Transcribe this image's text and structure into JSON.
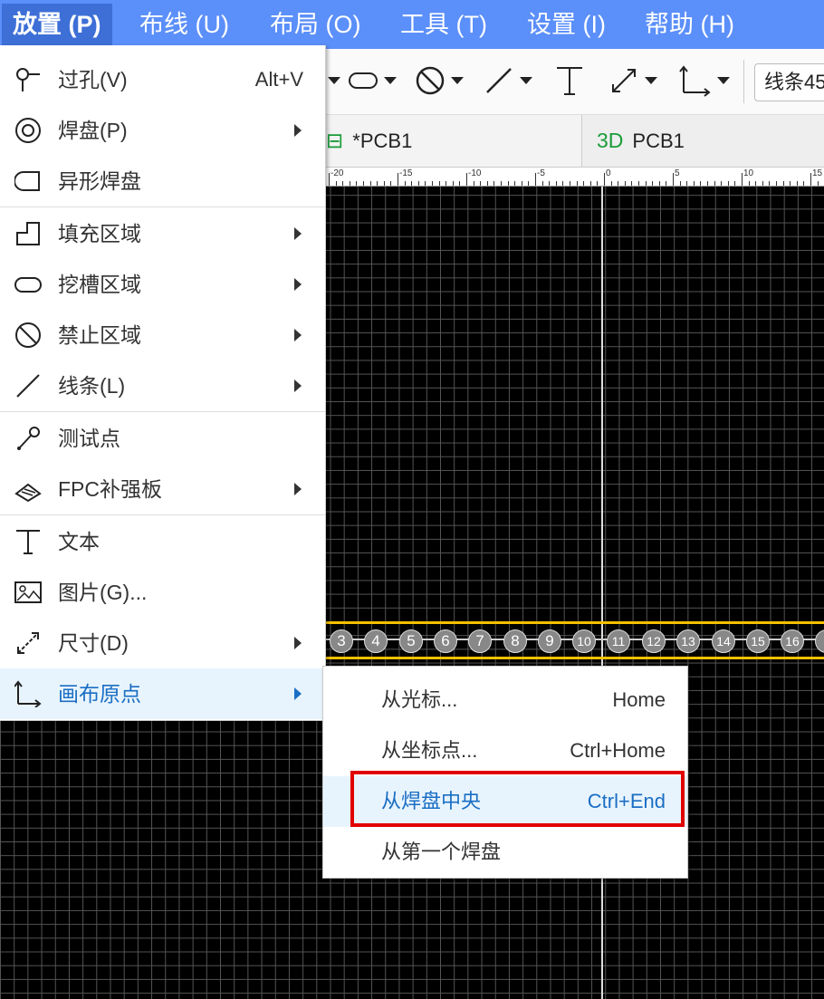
{
  "menubar": {
    "items": [
      "放置 (P)",
      "布线 (U)",
      "布局 (O)",
      "工具 (T)",
      "设置 (I)",
      "帮助 (H)"
    ],
    "active_index": 0
  },
  "toolbar": {
    "icons": [
      "pad-shape-icon",
      "oval-icon",
      "forbid-icon",
      "line-icon",
      "text-icon",
      "dimension-icon",
      "origin-icon"
    ],
    "layer_select_value": "线条45"
  },
  "tabs": [
    {
      "icon_text": "⊟",
      "label": "*PCB1"
    },
    {
      "icon_text": "3D",
      "label": "PCB1"
    }
  ],
  "ruler": {
    "labels": [
      "-20",
      "-15",
      "-10",
      "-5",
      "0",
      "5",
      "10",
      "15"
    ]
  },
  "pads": [
    "3",
    "4",
    "5",
    "6",
    "7",
    "8",
    "9",
    "10",
    "11",
    "12",
    "13",
    "14",
    "15",
    "16",
    "1"
  ],
  "colors": {
    "menubar": "#5b8ff9",
    "hover_text": "#1a6ec4",
    "hover_bg": "#e8f4fd",
    "highlight": "#e00000",
    "pad_track": "#f5c000"
  },
  "menu": {
    "items": [
      {
        "icon": "via-icon",
        "label": "过孔(V)",
        "shortcut": "Alt+V"
      },
      {
        "icon": "pad-icon",
        "label": "焊盘(P)",
        "submenu": true
      },
      {
        "icon": "special-pad-icon",
        "label": "异形焊盘"
      },
      {
        "icon": "fill-region-icon",
        "label": "填充区域",
        "submenu": true
      },
      {
        "icon": "slot-region-icon",
        "label": "挖槽区域",
        "submenu": true
      },
      {
        "icon": "keepout-region-icon",
        "label": "禁止区域",
        "submenu": true
      },
      {
        "icon": "line-icon",
        "label": "线条(L)",
        "submenu": true
      },
      {
        "icon": "test-point-icon",
        "label": "测试点"
      },
      {
        "icon": "fpc-stiffener-icon",
        "label": "FPC补强板",
        "submenu": true
      },
      {
        "icon": "text-icon",
        "label": "文本"
      },
      {
        "icon": "image-icon",
        "label": "图片(G)..."
      },
      {
        "icon": "dimension-icon",
        "label": "尺寸(D)",
        "submenu": true
      },
      {
        "icon": "canvas-origin-icon",
        "label": "画布原点",
        "submenu": true,
        "hover": true
      }
    ]
  },
  "submenu": {
    "items": [
      {
        "label": "从光标...",
        "shortcut": "Home"
      },
      {
        "label": "从坐标点...",
        "shortcut": "Ctrl+Home"
      },
      {
        "label": "从焊盘中央",
        "shortcut": "Ctrl+End",
        "hover": true,
        "highlighted": true
      },
      {
        "label": "从第一个焊盘",
        "shortcut": ""
      }
    ]
  }
}
